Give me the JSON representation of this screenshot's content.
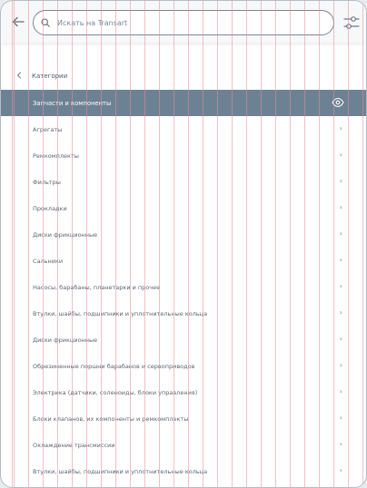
{
  "search": {
    "placeholder": "Искать на Transart"
  },
  "breadcrumb": {
    "label": "Категории"
  },
  "active_category": {
    "label": "Запчасти и компоненты"
  },
  "items": [
    "Агрегаты",
    "Ремкомплекты",
    "Фильтры",
    "Прокладки",
    "Диски фрикционные",
    "Сальники",
    "Насосы, барабаны, планетарки и прочее",
    "Втулки, шайбы, подшипники и уплотнительные кольца",
    "Диски фрикционные",
    "Обрезиненные поршни барабанов и сервоприводов",
    "Электрика (датчики, соленоиды, блоки управления)",
    "Блоки клапанов, их компоненты и ремкомплекты",
    "Охлаждение трансмиссии",
    "Втулки, шайбы, подшипники и уплотнительные кольца"
  ],
  "icons": {
    "back": "arrow-left-icon",
    "search": "search-icon",
    "filter": "sliders-icon",
    "crumb": "chevron-left-icon",
    "eye": "eye-icon",
    "row": "chevron-right-icon"
  },
  "colors": {
    "active_row": "#6c8294",
    "guides": "#e88c96"
  }
}
